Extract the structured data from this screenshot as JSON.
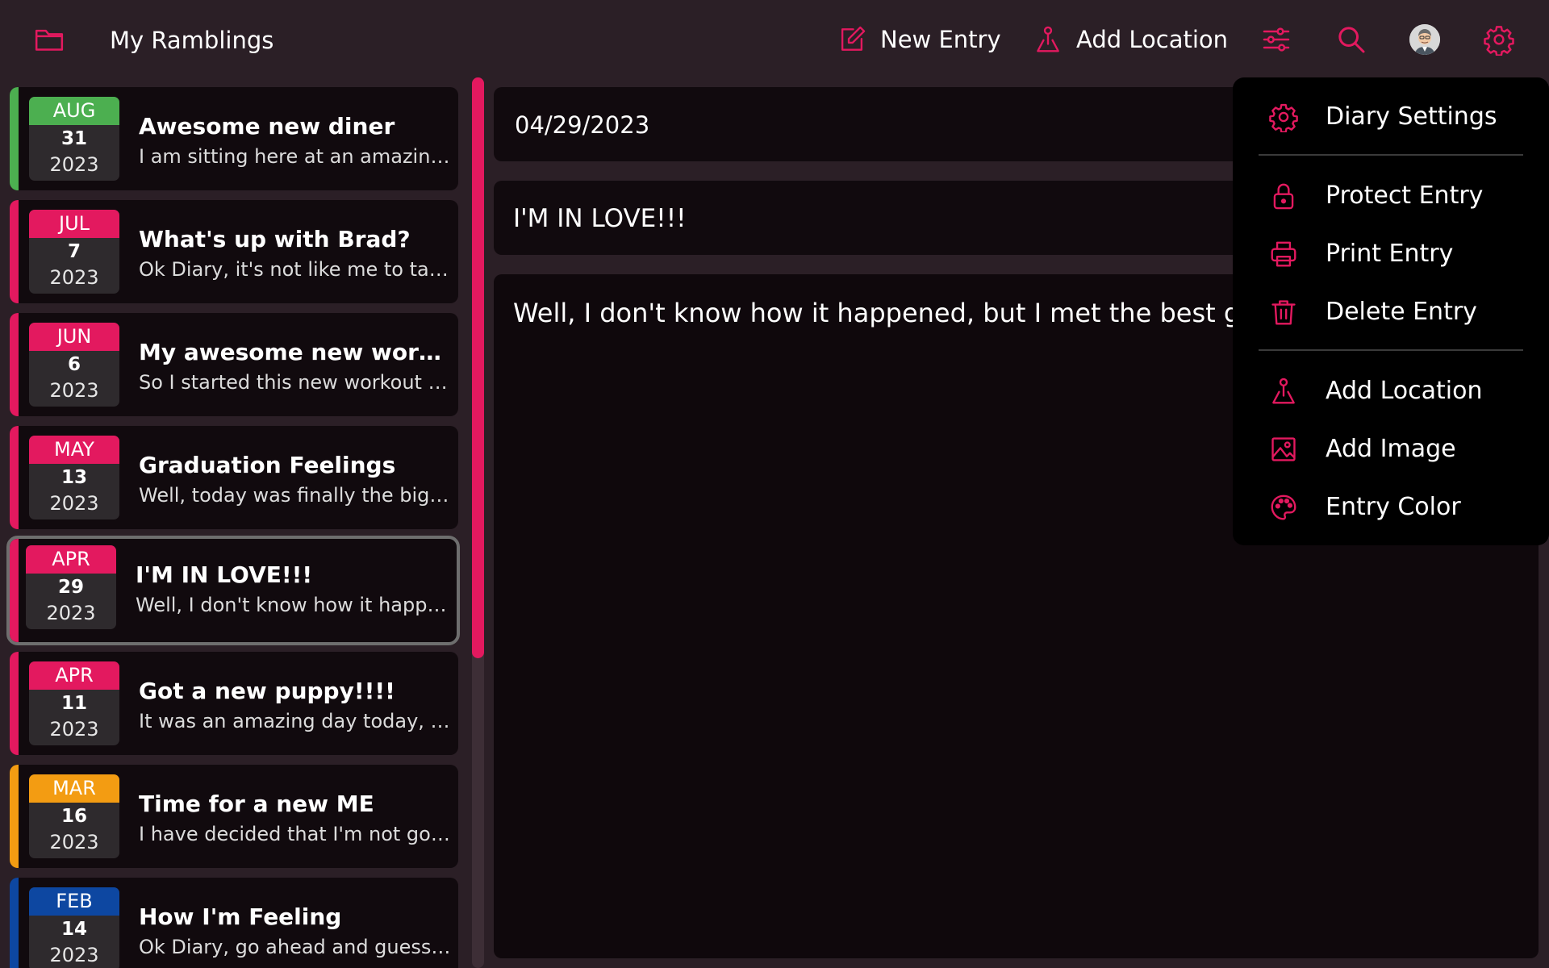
{
  "app": {
    "title": "My Ramblings",
    "accent_color": "#e3195f"
  },
  "toolbar": {
    "new_entry_label": "New Entry",
    "add_location_label": "Add Location",
    "icons": [
      "folder-icon",
      "edit-icon",
      "location-pin-icon",
      "sliders-icon",
      "search-icon",
      "avatar",
      "gear-icon"
    ]
  },
  "entries": [
    {
      "month": "AUG",
      "day": "31",
      "year": "2023",
      "title": "Awesome new diner",
      "snippet": "I am sitting here at an amazing new diner",
      "color": "#4caf50"
    },
    {
      "month": "JUL",
      "day": "7",
      "year": "2023",
      "title": "What's up with Brad?",
      "snippet": "Ok Diary, it's not like me to talk about",
      "color": "#e3195f"
    },
    {
      "month": "JUN",
      "day": "6",
      "year": "2023",
      "title": "My awesome new workout routine",
      "snippet": "So I started this new workout routine",
      "color": "#e3195f"
    },
    {
      "month": "MAY",
      "day": "13",
      "year": "2023",
      "title": "Graduation Feelings",
      "snippet": "Well, today was finally the big graduation",
      "color": "#e3195f"
    },
    {
      "month": "APR",
      "day": "29",
      "year": "2023",
      "title": "I'M IN LOVE!!!",
      "snippet": "Well, I don't know how it happened, but",
      "color": "#e3195f",
      "selected": true
    },
    {
      "month": "APR",
      "day": "11",
      "year": "2023",
      "title": "Got a new puppy!!!!",
      "snippet": "It was an amazing day today, as we went",
      "color": "#e3195f"
    },
    {
      "month": "MAR",
      "day": "16",
      "year": "2023",
      "title": "Time for a new ME",
      "snippet": "I have decided that I'm not going to",
      "color": "#f39c12"
    },
    {
      "month": "FEB",
      "day": "14",
      "year": "2023",
      "title": "How I'm Feeling",
      "snippet": "Ok Diary, go ahead and guess what",
      "color": "#0d47a1"
    }
  ],
  "editor": {
    "date": "04/29/2023",
    "title": "I'M IN LOVE!!!",
    "body": "Well, I don't know how it happened, but I met the best guy"
  },
  "menu": {
    "items": [
      {
        "label": "Diary Settings",
        "icon": "gear-icon"
      },
      {
        "label": "Protect Entry",
        "icon": "lock-icon"
      },
      {
        "label": "Print Entry",
        "icon": "printer-icon"
      },
      {
        "label": "Delete Entry",
        "icon": "trash-icon"
      },
      {
        "label": "Add Location",
        "icon": "location-pin-icon"
      },
      {
        "label": "Add Image",
        "icon": "image-icon"
      },
      {
        "label": "Entry Color",
        "icon": "palette-icon"
      }
    ]
  }
}
